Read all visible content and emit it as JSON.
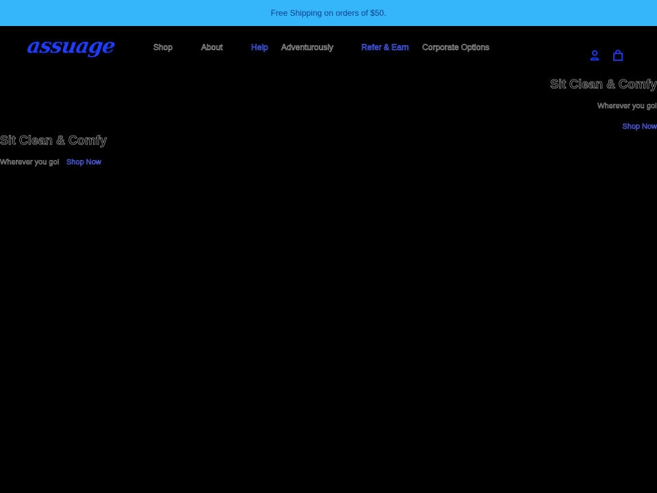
{
  "announcement": {
    "text": "Free Shipping on orders of $50."
  },
  "header": {
    "logo_text": "assuage",
    "nav": [
      {
        "label": "Shop"
      },
      {
        "label": "About"
      },
      {
        "label": "Help"
      },
      {
        "label": "Adventurously"
      },
      {
        "label": "Refer & Earn"
      },
      {
        "label": "Corporate Options"
      }
    ],
    "icons": [
      "account-icon",
      "cart-icon"
    ]
  },
  "slides": [
    {
      "title": "Sit Clean & Comfy",
      "subtitle": "Wherever you go!",
      "cta": "Shop Now"
    },
    {
      "title": "Sit Clean & Comfy",
      "subtitle": "Wherever you go!",
      "cta": "Shop Now"
    }
  ],
  "colors": {
    "announcement_bg": "#35b5fa",
    "brand_blue": "#1e3cff",
    "page_bg": "#000000"
  }
}
